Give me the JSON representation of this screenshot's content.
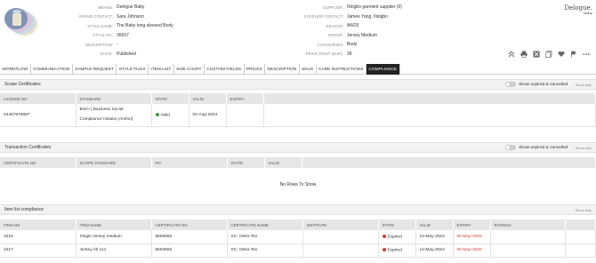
{
  "header": {
    "fields_left": [
      {
        "label": "BRAND:",
        "value": "Delogue Baby"
      },
      {
        "label": "BRAND CONTACT:",
        "value": "Sara Johnson"
      },
      {
        "label": "STYLE NAME:",
        "value": "The Baby long sleeved Body"
      },
      {
        "label": "STYLE NO:",
        "value": "30007"
      },
      {
        "label": "DESCRIPTION:",
        "value": "-"
      },
      {
        "label": "STATE:",
        "value": "Published"
      }
    ],
    "fields_right": [
      {
        "label": "SUPPLIER:",
        "value": "Ningbo garment supplier (0)"
      },
      {
        "label": "SUPPLIER CONTACT:",
        "value": "James Yang, Ningbo"
      },
      {
        "label": "SEASON:",
        "value": "AW25"
      },
      {
        "label": "GROUP:",
        "value": "Jersey Medium"
      },
      {
        "label": "CATEGORIES:",
        "value": "Body"
      },
      {
        "label": "PRICE POINT (EUR):",
        "value": "39"
      }
    ],
    "logo_line1": "Delogue.",
    "logo_line2": "baby",
    "icons": [
      "home-up-icon",
      "print-icon",
      "excel-icon",
      "copy-icon",
      "heart-icon",
      "flag-icon",
      "more-icon"
    ]
  },
  "tabs": [
    "WORKFLOW",
    "COMMUNICATION",
    "SAMPLE REQUEST",
    "STYLE FILES",
    "ITEM LIST",
    "SIZE CHART",
    "CUSTOM FIELDS",
    "PRICES",
    "DESCRIPTION",
    "SKUS",
    "CARE INSTRUCTIONS",
    "COMPLIANCE"
  ],
  "active_tab": "COMPLIANCE",
  "scope": {
    "title": "Scope Certificates",
    "toggle_label": "Show expired & cancelled",
    "show_less": "- Show less",
    "columns": [
      "LICENSE NO",
      "STANDARD",
      "STATE",
      "VALID",
      "EXPIRY"
    ],
    "row": {
      "license": "23457879897",
      "standard1": "BSCI | Business Social",
      "standard2": "Compliance Initiativ (Amfori)",
      "state": "Valid",
      "valid": "02-Aug-2024",
      "expiry": ""
    }
  },
  "transaction": {
    "title": "Transaction Certificates",
    "toggle_label": "Show expired & cancelled",
    "show_less": "- Show less",
    "columns": [
      "CERTIFICATE NO",
      "SCOPE STANDARD",
      "PO",
      "STATE",
      "VALID"
    ],
    "empty": "No Rows To Show"
  },
  "itemlist": {
    "title": "Item list compliance",
    "show_less": "- Show less",
    "columns": [
      "ITEM NO",
      "ITEM NAME",
      "CERTIFICATE NO",
      "CERTIFICATE NAME",
      "INSTITUTE",
      "STATE",
      "VALID",
      "EXPIRY",
      "RATINGS"
    ],
    "rows": [
      {
        "item_no": "1016",
        "item_name": "Single Jersey medium",
        "cert_no": "8593583",
        "cert_name": "SC: Oeko-Tex",
        "institute": "",
        "state": "Expired",
        "valid": "14-May-2024",
        "expiry": "06-May-2025",
        "ratings": ""
      },
      {
        "item_no": "1017",
        "item_name": "Jersey rib 1x1",
        "cert_no": "8593583",
        "cert_name": "SC: Oeko-Tex",
        "institute": "",
        "state": "Expired",
        "valid": "14-May-2024",
        "expiry": "06-May-2025",
        "ratings": ""
      }
    ]
  },
  "colors": {
    "active_tab_bg": "#222222",
    "valid_dot": "#3c9a45",
    "expired_dot": "#d43c34",
    "expiry_text": "#d43c34"
  }
}
